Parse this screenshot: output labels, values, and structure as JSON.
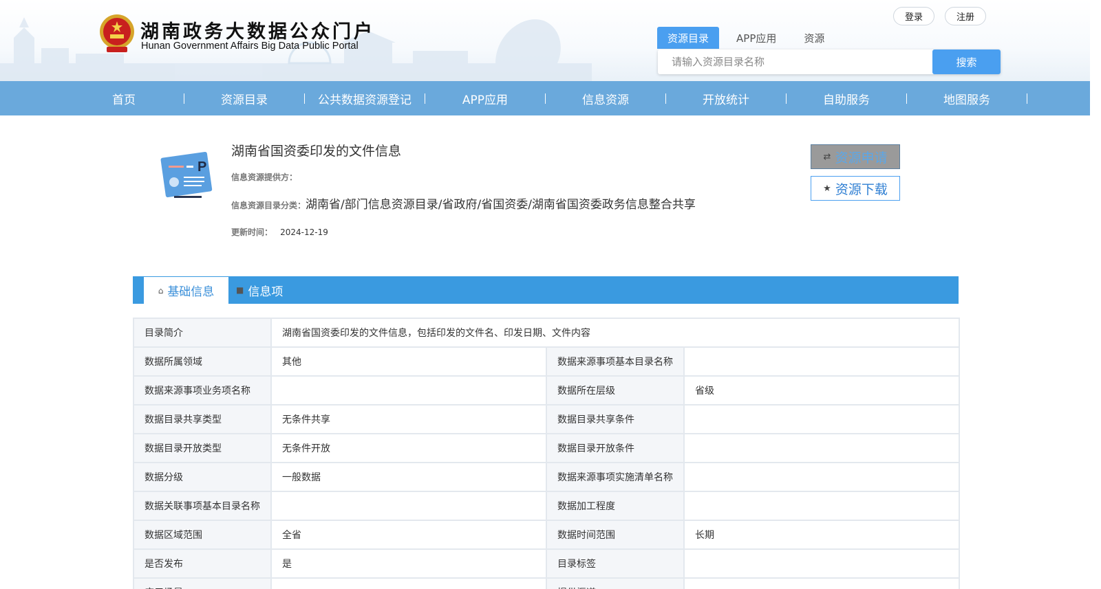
{
  "header": {
    "logo_cn": "湖南政务大数据公众门户",
    "logo_en": "Hunan Government Affairs Big Data Public Portal",
    "login": "登录",
    "register": "注册"
  },
  "search": {
    "tabs": [
      "资源目录",
      "APP应用",
      "资源"
    ],
    "placeholder": "请输入资源目录名称",
    "button": "搜索"
  },
  "nav": {
    "items": [
      "首页",
      "资源目录",
      "公共数据资源登记",
      "APP应用",
      "信息资源",
      "开放统计",
      "自助服务",
      "地图服务"
    ]
  },
  "resource": {
    "title": "湖南省国资委印发的文件信息",
    "provider_label": "信息资源提供方：",
    "provider_value": "",
    "category_label": "信息资源目录分类：",
    "category_value": "湖南省/部门信息资源目录/省政府/省国资委/湖南省国资委政务信息整合共享",
    "updated_label": "更新时间：",
    "updated_value": "2024-12-19",
    "apply_button": "资源申请",
    "download_button": "资源下载"
  },
  "tabs": {
    "basic": "基础信息",
    "items": "信息项"
  },
  "table": {
    "summary_label": "目录简介",
    "summary_value": "湖南省国资委印发的文件信息，包括印发的文件名、印发日期、文件内容",
    "rows": [
      [
        "数据所属领域",
        "其他",
        "数据来源事项基本目录名称",
        ""
      ],
      [
        "数据来源事项业务项名称",
        "",
        "数据所在层级",
        "省级"
      ],
      [
        "数据目录共享类型",
        "无条件共享",
        "数据目录共享条件",
        ""
      ],
      [
        "数据目录开放类型",
        "无条件开放",
        "数据目录开放条件",
        ""
      ],
      [
        "数据分级",
        "一般数据",
        "数据来源事项实施清单名称",
        ""
      ],
      [
        "数据关联事项基本目录名称",
        "",
        "数据加工程度",
        ""
      ],
      [
        "数据区域范围",
        "全省",
        "数据时间范围",
        "长期"
      ],
      [
        "是否发布",
        "是",
        "目录标签",
        ""
      ],
      [
        "应用场景",
        "",
        "提供渠道",
        ""
      ]
    ]
  },
  "colors": {
    "nav_bg": "#6aa9dc",
    "accent": "#4a9ff0",
    "tabbar": "#3a9ae0"
  },
  "icons": {
    "emblem": "national-emblem-icon",
    "resource": "document-card-icon",
    "apply": "shuffle-icon",
    "download": "star-icon",
    "basic_tab": "home-icon",
    "items_tab": "folder-icon"
  }
}
